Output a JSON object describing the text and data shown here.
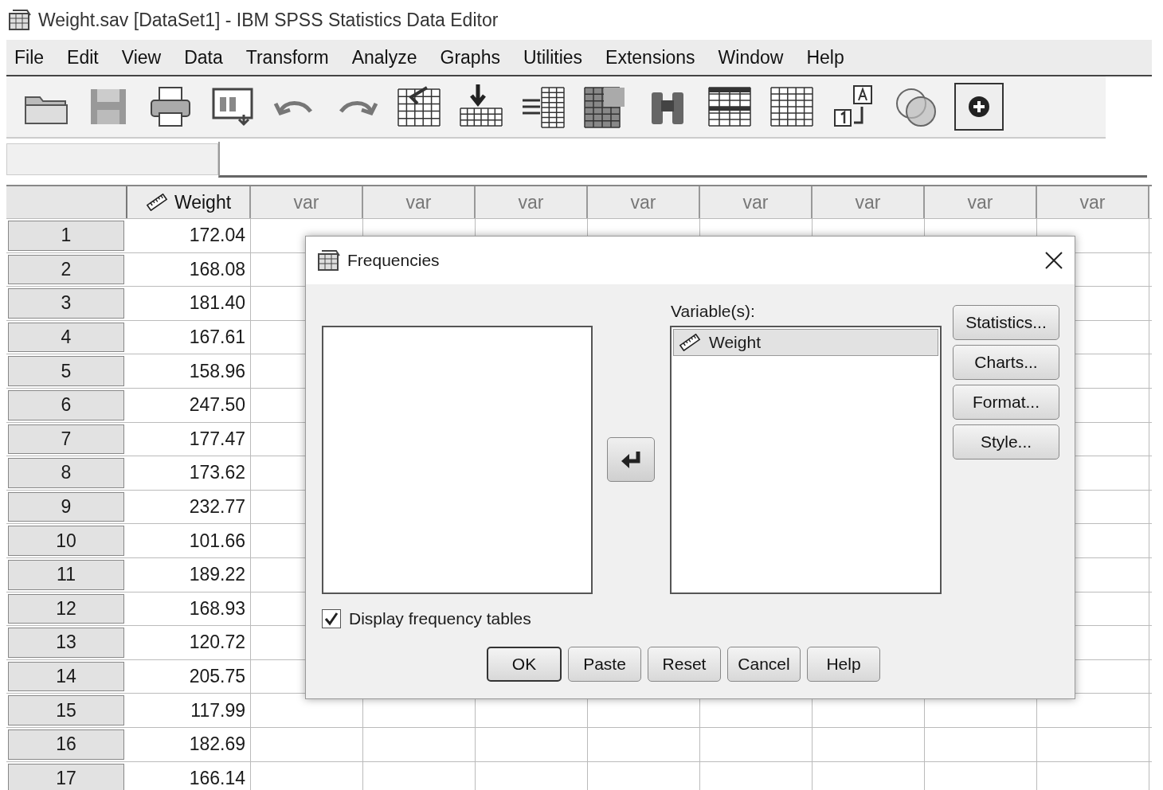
{
  "window": {
    "title": "Weight.sav [DataSet1] - IBM SPSS Statistics Data Editor"
  },
  "menu": [
    "File",
    "Edit",
    "View",
    "Data",
    "Transform",
    "Analyze",
    "Graphs",
    "Utilities",
    "Extensions",
    "Window",
    "Help"
  ],
  "grid": {
    "columns": [
      {
        "label": "Weight",
        "kind": "scale"
      },
      {
        "label": "var",
        "kind": "empty"
      },
      {
        "label": "var",
        "kind": "empty"
      },
      {
        "label": "var",
        "kind": "empty"
      },
      {
        "label": "var",
        "kind": "empty"
      },
      {
        "label": "var",
        "kind": "empty"
      },
      {
        "label": "var",
        "kind": "empty"
      },
      {
        "label": "var",
        "kind": "empty"
      },
      {
        "label": "var",
        "kind": "empty"
      }
    ],
    "rows": [
      {
        "number": "1",
        "value": "172.04"
      },
      {
        "number": "2",
        "value": "168.08"
      },
      {
        "number": "3",
        "value": "181.40"
      },
      {
        "number": "4",
        "value": "167.61"
      },
      {
        "number": "5",
        "value": "158.96"
      },
      {
        "number": "6",
        "value": "247.50"
      },
      {
        "number": "7",
        "value": "177.47"
      },
      {
        "number": "8",
        "value": "173.62"
      },
      {
        "number": "9",
        "value": "232.77"
      },
      {
        "number": "10",
        "value": "101.66"
      },
      {
        "number": "11",
        "value": "189.22"
      },
      {
        "number": "12",
        "value": "168.93"
      },
      {
        "number": "13",
        "value": "120.72"
      },
      {
        "number": "14",
        "value": "205.75"
      },
      {
        "number": "15",
        "value": "117.99"
      },
      {
        "number": "16",
        "value": "182.69"
      },
      {
        "number": "17",
        "value": "166.14"
      }
    ]
  },
  "dialog": {
    "title": "Frequencies",
    "target_label": "Variable(s):",
    "target_items": [
      {
        "label": "Weight",
        "selected": true
      }
    ],
    "side_buttons": [
      "Statistics...",
      "Charts...",
      "Format...",
      "Style..."
    ],
    "checkbox": {
      "label": "Display frequency tables",
      "checked": true
    },
    "buttons": [
      {
        "label": "OK",
        "default": true
      },
      {
        "label": "Paste",
        "default": false
      },
      {
        "label": "Reset",
        "default": false
      },
      {
        "label": "Cancel",
        "default": false
      },
      {
        "label": "Help",
        "default": false
      }
    ]
  }
}
